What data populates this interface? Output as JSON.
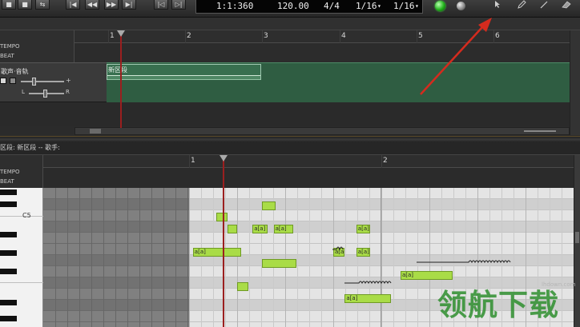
{
  "toolbar": {
    "transport_buttons": [
      "■",
      "■",
      "⇆",
      "|◀",
      "◀◀",
      "▶▶",
      "▶|",
      "|◁",
      "▷|"
    ],
    "position": "1:1:360",
    "tempo": "120.00",
    "time_signature": "4/4",
    "quantize": "1/16",
    "note_length": "1/16",
    "dropdown_glyph": "▾",
    "tools": [
      "pointer-icon",
      "pencil-icon",
      "line-icon",
      "eraser-icon"
    ]
  },
  "arranger": {
    "ruler_labels": [
      "1",
      "2",
      "3",
      "4",
      "5",
      "6"
    ],
    "lane_labels": [
      "TEMPO",
      "BEAT"
    ],
    "track_name": "歌声·音轨",
    "volume_plus": "+",
    "pan_left": "L",
    "pan_right": "R",
    "region_label": "新区段"
  },
  "piano_roll": {
    "title": "区段: 新区段  --  歌手:",
    "ruler_labels": [
      "1",
      "2"
    ],
    "lane_labels": [
      "TEMPO",
      "BEAT"
    ],
    "c5_label": "C5",
    "notes": [
      {
        "lyric": "",
        "start": 1.38,
        "end": 1.45,
        "row": 1
      },
      {
        "lyric": "",
        "start": 1.14,
        "end": 1.2,
        "row": 2
      },
      {
        "lyric": "",
        "start": 1.2,
        "end": 1.25,
        "row": 3
      },
      {
        "lyric": "a[a]",
        "start": 1.33,
        "end": 1.41,
        "row": 3
      },
      {
        "lyric": "a[a]",
        "start": 1.44,
        "end": 1.54,
        "row": 3
      },
      {
        "lyric": "a[a]",
        "start": 1.87,
        "end": 1.94,
        "row": 3
      },
      {
        "lyric": "a[a]",
        "start": 1.02,
        "end": 1.27,
        "row": 5
      },
      {
        "lyric": "a[a]",
        "start": 1.75,
        "end": 1.81,
        "row": 5
      },
      {
        "lyric": "a[a]",
        "start": 1.87,
        "end": 1.94,
        "row": 5
      },
      {
        "lyric": "",
        "start": 1.38,
        "end": 1.56,
        "row": 6
      },
      {
        "lyric": "a[a]",
        "start": 2.1,
        "end": 2.37,
        "row": 7
      },
      {
        "lyric": "",
        "start": 1.25,
        "end": 1.31,
        "row": 8
      },
      {
        "lyric": "a[a]",
        "start": 1.81,
        "end": 2.05,
        "row": 9
      }
    ]
  },
  "watermark": {
    "url": "lhdown.com",
    "text": "领航下载"
  },
  "colors": {
    "track_green": "#2f5d42",
    "note_green": "#a9dc47",
    "playhead": "#9b1f1f",
    "annotation_arrow": "#d42b1e",
    "led_green": "#21b21b"
  }
}
